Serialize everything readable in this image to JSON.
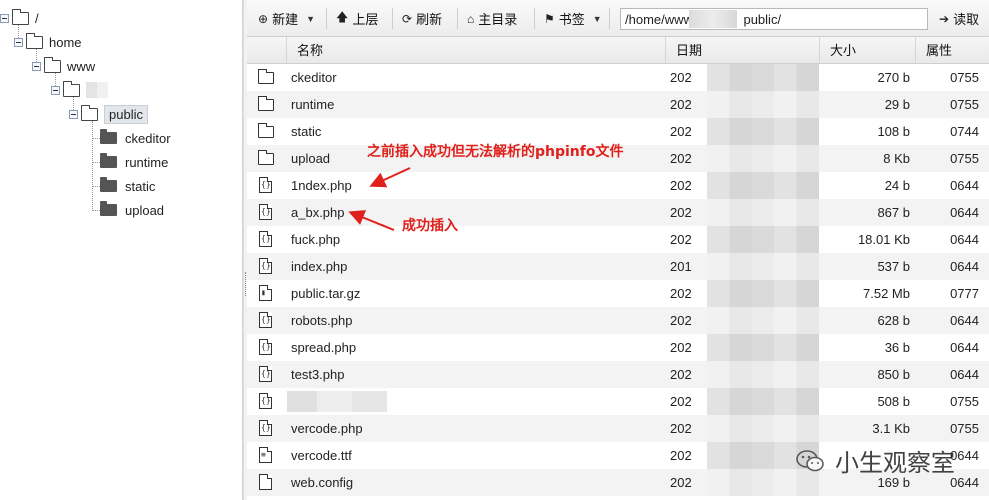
{
  "tree": {
    "nodes": [
      {
        "label": "/"
      },
      {
        "label": "home"
      },
      {
        "label": "www"
      },
      {
        "label": ""
      },
      {
        "label": "public"
      },
      {
        "label": "ckeditor"
      },
      {
        "label": "runtime"
      },
      {
        "label": "static"
      },
      {
        "label": "upload"
      }
    ]
  },
  "toolbar": {
    "new_label": "新建",
    "up_label": "上层",
    "refresh_label": "刷新",
    "home_label": "主目录",
    "bookmark_label": "书签",
    "path_value": "/home/www/             public/",
    "read_label": "读取"
  },
  "table": {
    "headers": {
      "name": "名称",
      "date": "日期",
      "size": "大小",
      "attr": "属性"
    },
    "rows": [
      {
        "type": "folder",
        "name": "ckeditor",
        "date": "202",
        "size": "270 b",
        "attr": "0755"
      },
      {
        "type": "folder",
        "name": "runtime",
        "date": "202",
        "size": "29 b",
        "attr": "0755"
      },
      {
        "type": "folder",
        "name": "static",
        "date": "202",
        "size": "108 b",
        "attr": "0744"
      },
      {
        "type": "folder",
        "name": "upload",
        "date": "202",
        "size": "8 Kb",
        "attr": "0755"
      },
      {
        "type": "code",
        "name": "1ndex.php",
        "date": "202",
        "size": "24 b",
        "attr": "0644"
      },
      {
        "type": "code",
        "name": "a_bx.php",
        "date": "202",
        "size": "867 b",
        "attr": "0644"
      },
      {
        "type": "code",
        "name": "fuck.php",
        "date": "202",
        "size": "18.01 Kb",
        "attr": "0644"
      },
      {
        "type": "code",
        "name": "index.php",
        "date": "201",
        "size": "537 b",
        "attr": "0644"
      },
      {
        "type": "archive",
        "name": "public.tar.gz",
        "date": "202",
        "size": "7.52 Mb",
        "attr": "0777"
      },
      {
        "type": "code",
        "name": "robots.php",
        "date": "202",
        "size": "628 b",
        "attr": "0644"
      },
      {
        "type": "code",
        "name": "spread.php",
        "date": "202",
        "size": "36 b",
        "attr": "0644"
      },
      {
        "type": "code",
        "name": "test3.php",
        "date": "202",
        "size": "850 b",
        "attr": "0644"
      },
      {
        "type": "code",
        "name": "",
        "date": "202",
        "size": "508 b",
        "attr": "0755"
      },
      {
        "type": "code",
        "name": "vercode.php",
        "date": "202",
        "size": "3.1 Kb",
        "attr": "0755"
      },
      {
        "type": "text",
        "name": "vercode.ttf",
        "date": "202",
        "size": "",
        "attr": "0644"
      },
      {
        "type": "blank",
        "name": "web.config",
        "date": "202",
        "size": "169 b",
        "attr": "0644"
      }
    ]
  },
  "annotations": {
    "note1": "之前插入成功但无法解析的phpinfo文件",
    "note2": "成功插入",
    "watermark": "小生观察室"
  },
  "colors": {
    "annotation": "#e0201b",
    "alt_row": "#f3f3f3"
  }
}
